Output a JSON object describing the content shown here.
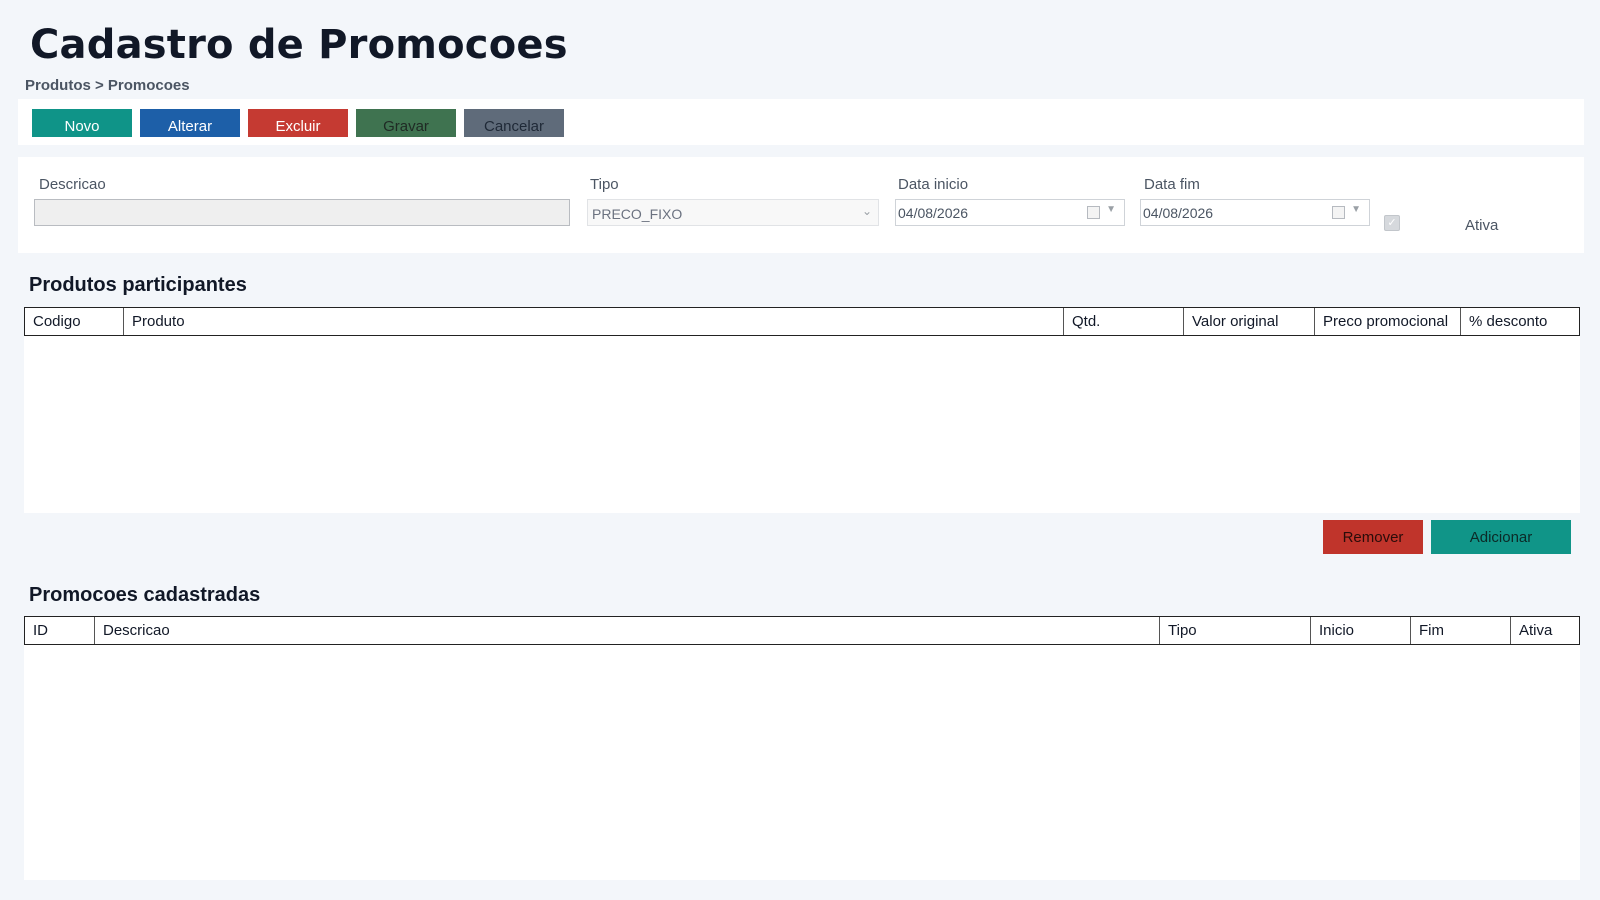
{
  "header": {
    "title": "Cadastro de Promocoes",
    "breadcrumb": "Produtos > Promocoes"
  },
  "toolbar": {
    "novo": "Novo",
    "alterar": "Alterar",
    "excluir": "Excluir",
    "gravar": "Gravar",
    "cancelar": "Cancelar"
  },
  "form": {
    "descricao_label": "Descricao",
    "descricao_value": "",
    "tipo_label": "Tipo",
    "tipo_value": "PRECO_FIXO",
    "data_inicio_label": "Data inicio",
    "data_inicio_value": "04/08/2026",
    "data_fim_label": "Data fim",
    "data_fim_value": "04/08/2026",
    "ativa_label": "Ativa",
    "ativa_checked": true
  },
  "produtos": {
    "title": "Produtos participantes",
    "columns": [
      "Codigo",
      "Produto",
      "Qtd.",
      "Valor original",
      "Preco promocional",
      "% desconto"
    ],
    "rows": [],
    "remover": "Remover",
    "adicionar": "Adicionar"
  },
  "promocoes": {
    "title": "Promocoes cadastradas",
    "columns": [
      "ID",
      "Descricao",
      "Tipo",
      "Inicio",
      "Fim",
      "Ativa"
    ],
    "rows": []
  },
  "colors": {
    "novo": "#0f9488",
    "alterar": "#1d5fa8",
    "excluir": "#c53a32",
    "gravar": "#3f7350",
    "cancelar": "#5f6b7a",
    "background": "#f3f6fa"
  }
}
